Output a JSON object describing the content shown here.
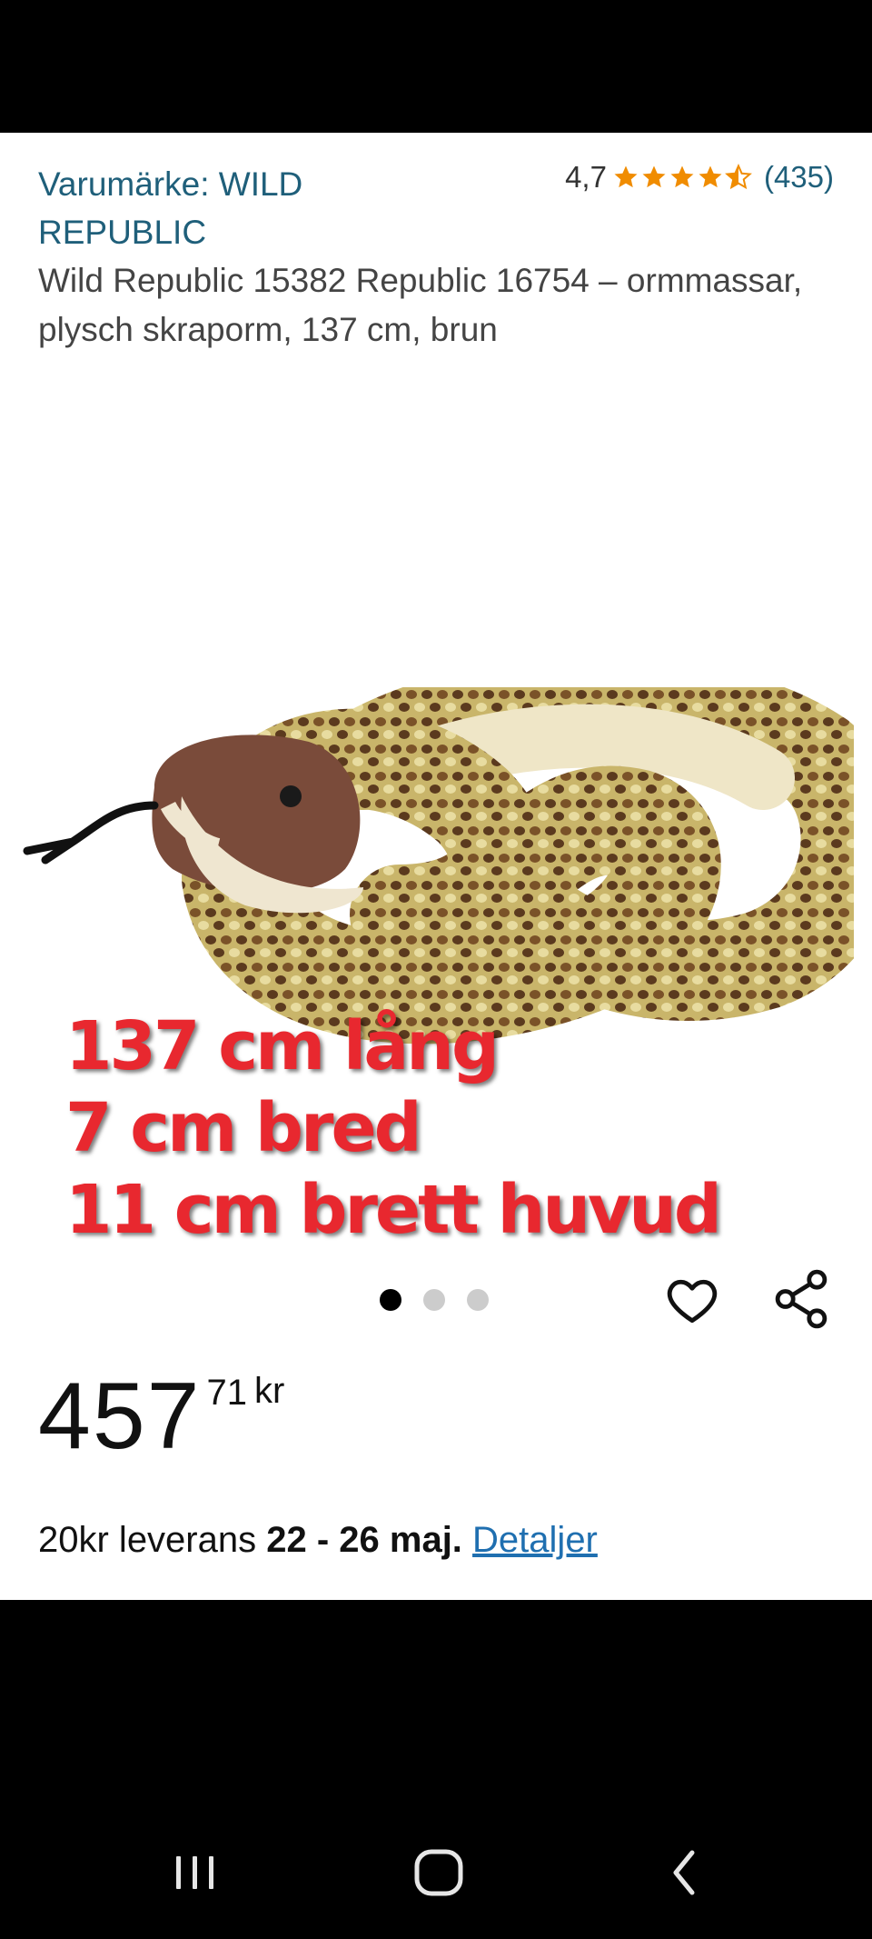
{
  "product": {
    "brand_line1": "Varumärke: WILD",
    "brand_line2": "REPUBLIC",
    "rating_score": "4,7",
    "rating_stars": 4.5,
    "rating_count": "(435)",
    "title": "Wild Republic 15382 Republic 16754 – ormmassar, plysch skraporm, 137 cm, brun"
  },
  "image": {
    "overlay_lines": [
      "137 cm lång",
      "7 cm bred",
      "11 cm brett huvud"
    ],
    "carousel_count": 3,
    "carousel_active": 1
  },
  "price": {
    "whole": "457",
    "fraction": "71",
    "currency": "kr"
  },
  "delivery": {
    "prefix": "20kr leverans ",
    "dates": "22 - 26 maj.",
    "details_link": "Detaljer"
  },
  "icons": {
    "wishlist": "heart-icon",
    "share": "share-icon",
    "recents": "recents-icon",
    "home": "home-icon",
    "back": "back-icon"
  },
  "colors": {
    "brand_link": "#1f5f7a",
    "star": "#f08c00",
    "overlay_text": "#e8282f",
    "details_link": "#1f6fb0"
  }
}
